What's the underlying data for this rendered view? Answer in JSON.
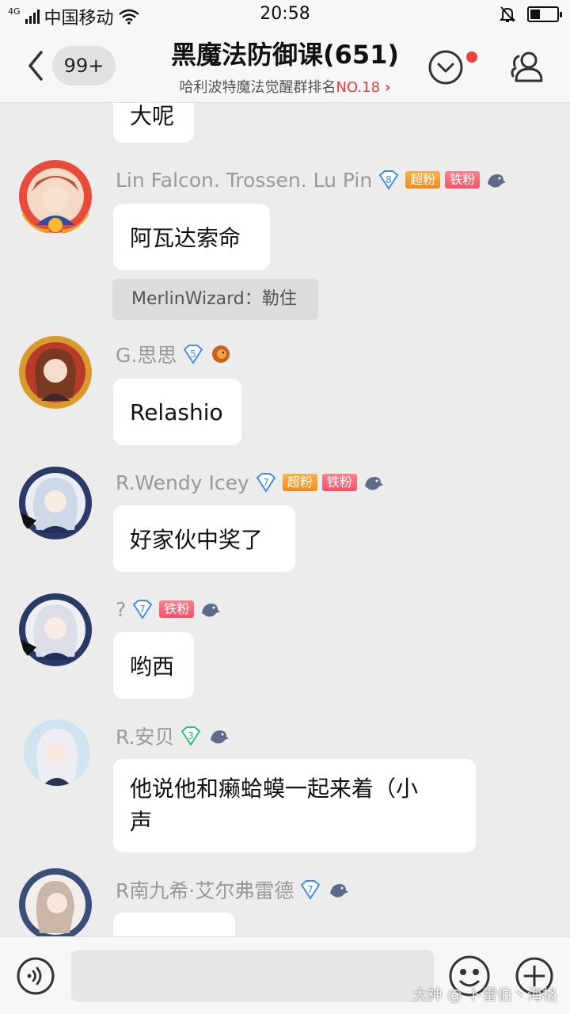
{
  "status_bar": {
    "network": "4G",
    "carrier": "中国移动",
    "time": "20:58"
  },
  "header": {
    "unread_count": "99+",
    "title": "黑魔法防御课(651)",
    "subtitle": "哈利波特魔法觉醒群排名",
    "rank": "NO.18"
  },
  "messages": [
    {
      "text": "大呢"
    },
    {
      "nickname": "Lin Falcon. Trossen. Lu Pin",
      "level": "8",
      "tags": [
        "超粉",
        "铁粉"
      ],
      "text": "阿瓦达索命"
    },
    {
      "nickname": "G.思思",
      "level": "5",
      "text": "Relashio"
    },
    {
      "nickname": "R.Wendy Icey",
      "level": "7",
      "tags": [
        "超粉",
        "铁粉"
      ],
      "text": "好家伙中奖了"
    },
    {
      "nickname": "?",
      "level": "7",
      "tags": [
        "铁粉"
      ],
      "text": "哟西"
    },
    {
      "nickname": "R.安贝",
      "level": "3",
      "text_line1": "他说他和癞蛤蟆一起来着（小",
      "text_line2": "声"
    },
    {
      "nickname": "R南九希·艾尔弗雷德",
      "level": "7",
      "text": ""
    }
  ],
  "notice": {
    "text": "MerlinWizard：勒住"
  },
  "input": {
    "placeholder": ""
  },
  "watermark": "大神 @ 卜雷伯丶海格",
  "colors": {
    "accent_red": "#ee3b3b",
    "super_fan": "#f39a2c",
    "iron_fan": "#f25467",
    "level_blue": "#3d8ee8",
    "level_green": "#2fbf71"
  }
}
